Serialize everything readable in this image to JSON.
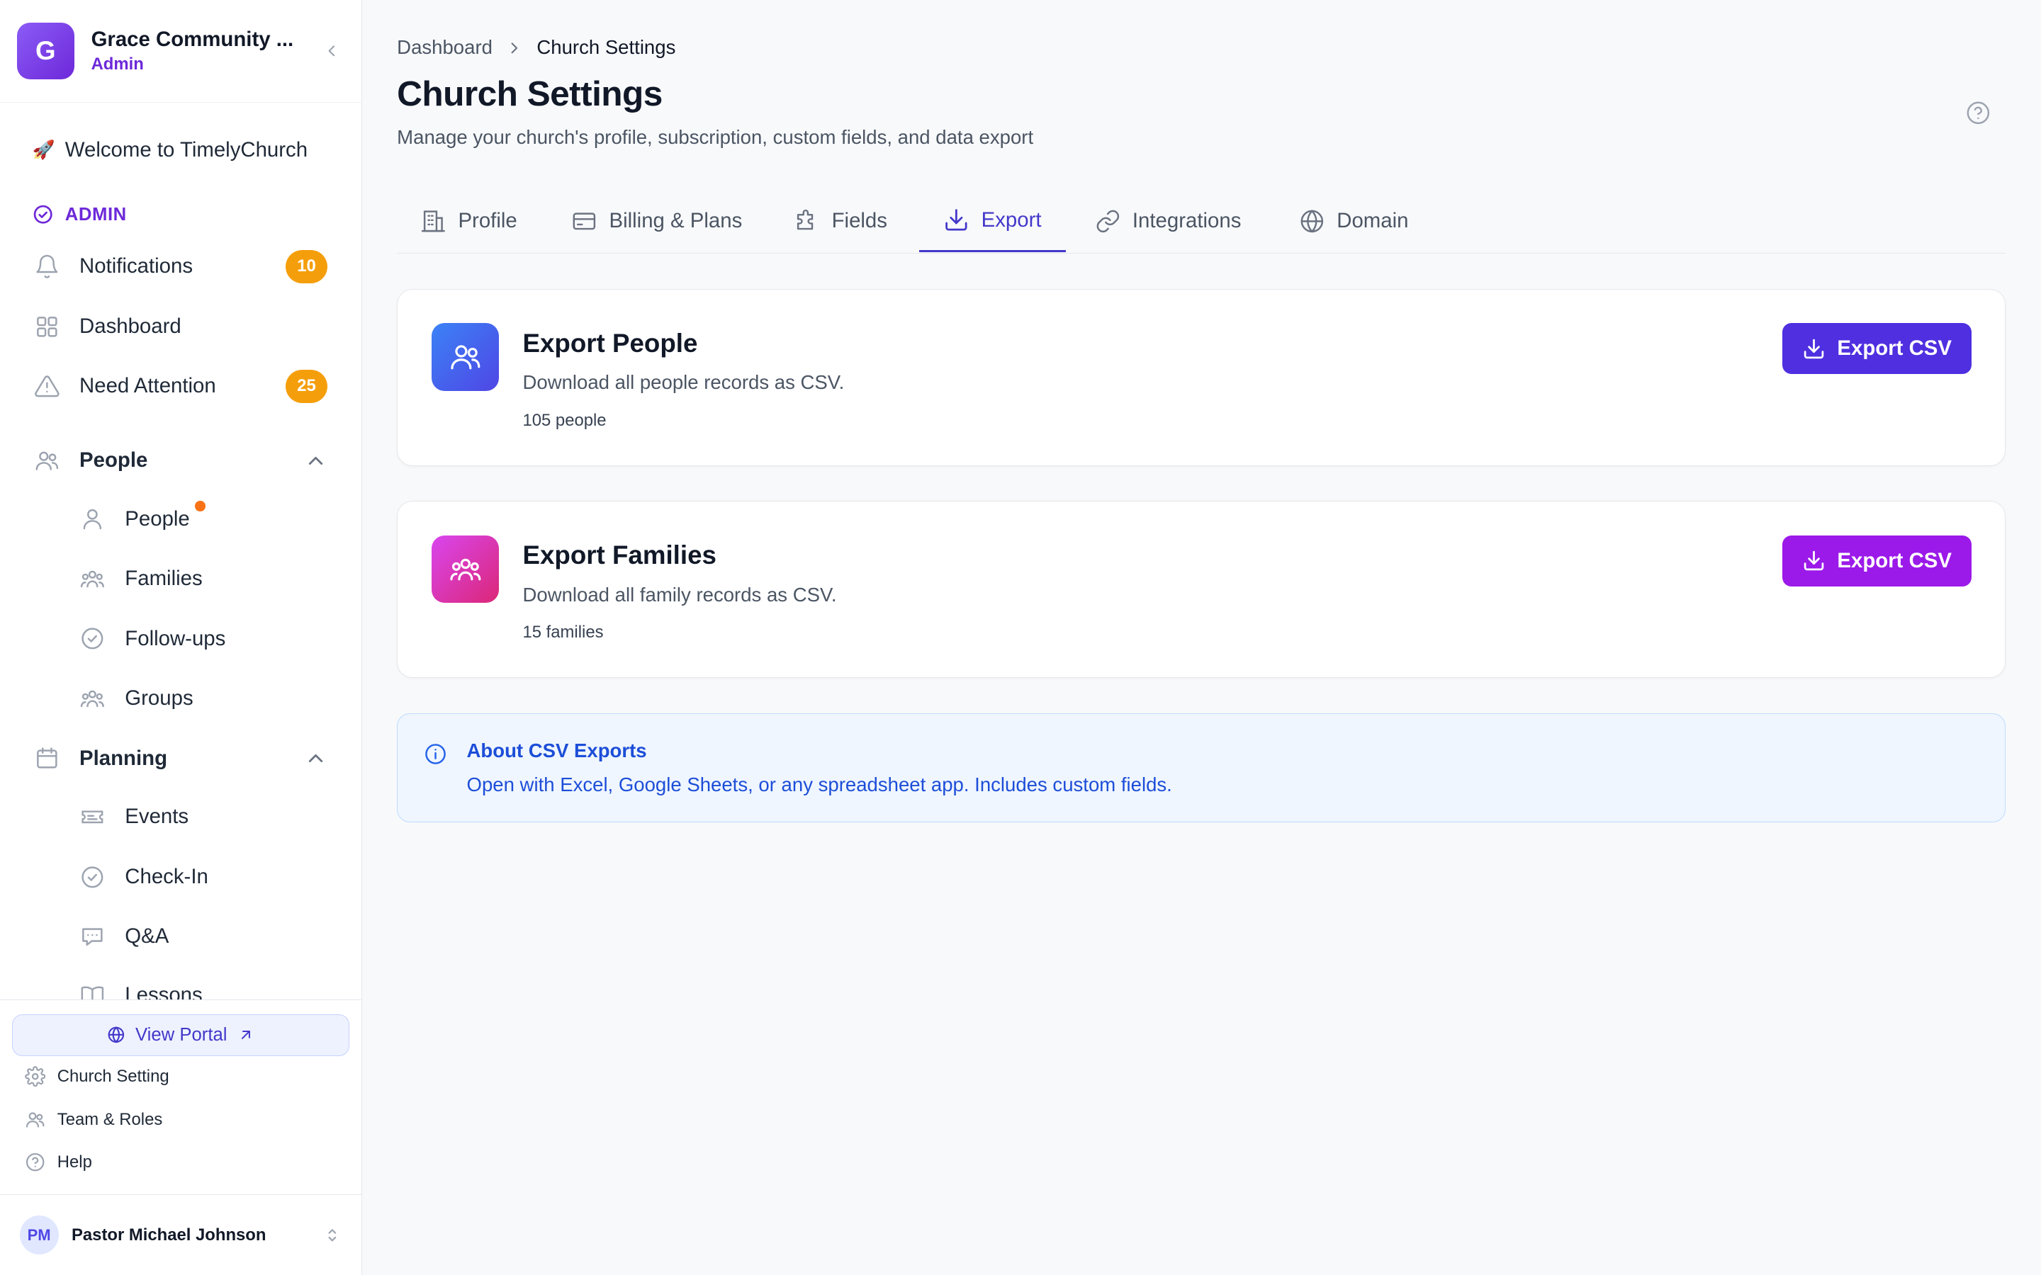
{
  "org": {
    "initial": "G",
    "name": "Grace Community ...",
    "role": "Admin"
  },
  "sidebar": {
    "welcome": "Welcome to TimelyChurch",
    "admin_heading": "ADMIN",
    "notifications": {
      "label": "Notifications",
      "badge": "10"
    },
    "dashboard": "Dashboard",
    "need_attention": {
      "label": "Need Attention",
      "badge": "25"
    },
    "people_group": "People",
    "people_items": [
      "People",
      "Families",
      "Follow-ups",
      "Groups"
    ],
    "planning_group": "Planning",
    "planning_items": [
      "Events",
      "Check-In",
      "Q&A",
      "Lessons"
    ],
    "view_portal": "View Portal",
    "church_setting": "Church Setting",
    "team_roles": "Team & Roles",
    "help": "Help",
    "user": {
      "initials": "PM",
      "name": "Pastor Michael Johnson"
    }
  },
  "breadcrumb": {
    "root": "Dashboard",
    "current": "Church Settings"
  },
  "page": {
    "title": "Church Settings",
    "subtitle": "Manage your church's profile, subscription, custom fields, and data export"
  },
  "tabs": [
    "Profile",
    "Billing & Plans",
    "Fields",
    "Export",
    "Integrations",
    "Domain"
  ],
  "active_tab": "Export",
  "export_people": {
    "title": "Export People",
    "description": "Download all people records as CSV.",
    "count": "105 people",
    "button": "Export CSV"
  },
  "export_families": {
    "title": "Export Families",
    "description": "Download all family records as CSV.",
    "count": "15 families",
    "button": "Export CSV"
  },
  "info": {
    "title": "About CSV Exports",
    "text": "Open with Excel, Google Sheets, or any spreadsheet app. Includes custom fields."
  },
  "colors": {
    "accent": "#4338ca",
    "people_button": "#4f2fe0",
    "families_button": "#9b19e9",
    "badge": "#f59e0b",
    "info_text": "#1d4ed8"
  },
  "icons": {
    "help": "help-circle-icon",
    "export": "download-icon",
    "info": "info-icon"
  }
}
